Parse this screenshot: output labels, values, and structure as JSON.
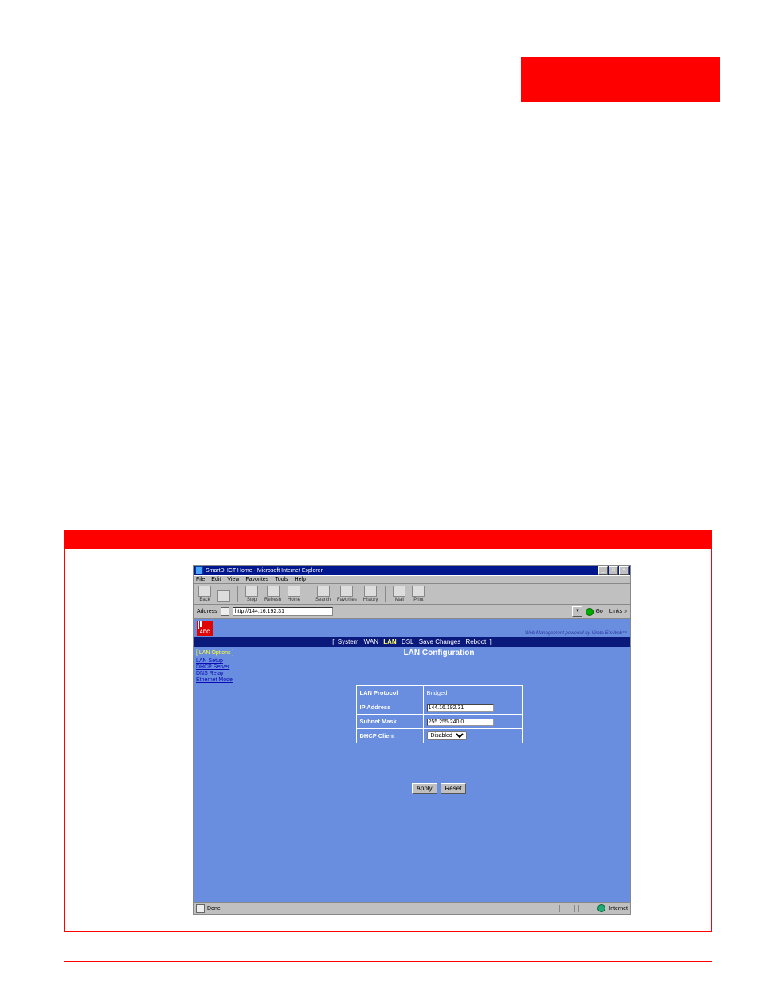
{
  "browser": {
    "window_title": "SmartDHCT Home - Microsoft Internet Explorer",
    "winbuttons": {
      "min": "_",
      "max": "□",
      "close": "×"
    },
    "menus": [
      "File",
      "Edit",
      "View",
      "Favorites",
      "Tools",
      "Help"
    ],
    "toolbar": {
      "back": "Back",
      "stop": "Stop",
      "refresh": "Refresh",
      "home": "Home",
      "search": "Search",
      "favorites": "Favorites",
      "history": "History",
      "mail": "Mail",
      "print": "Print"
    },
    "address_label": "Address",
    "url": "http://144.16.192.31",
    "go": "Go",
    "links": "Links »",
    "dd": "▼"
  },
  "logo": {
    "text": "ADC"
  },
  "powered_by": "Web Management powered by Virata-EmWeb™",
  "nav": {
    "open": "[",
    "close": "]",
    "items": {
      "system": "System",
      "wan": "WAN",
      "lan": "LAN",
      "dsl": "DSL",
      "save": "Save Changes",
      "reboot": "Reboot"
    }
  },
  "sidebar": {
    "title": "[ LAN Options ]",
    "items": [
      "LAN Setup",
      "DHCP Server",
      "DNS Relay",
      "Ethernet Mode"
    ]
  },
  "main": {
    "title": "LAN Configuration",
    "rows": {
      "proto_k": "LAN Protocol",
      "proto_v": "Bridged",
      "ip_k": "IP Address",
      "ip_v": "144.16.192.31",
      "mask_k": "Subnet Mask",
      "mask_v": "255.255.240.0",
      "dhcp_k": "DHCP Client",
      "dhcp_v": "Disabled"
    },
    "buttons": {
      "apply": "Apply",
      "reset": "Reset"
    }
  },
  "status": {
    "done": "Done",
    "zone": "Internet"
  }
}
